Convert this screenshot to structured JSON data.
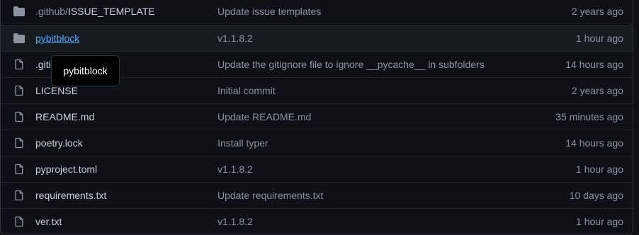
{
  "files": [
    {
      "icon": "folder-icon",
      "name_prefix": ".github/",
      "name": "ISSUE_TEMPLATE",
      "commit": "Update issue templates",
      "age": "2 years ago"
    },
    {
      "icon": "folder-icon",
      "name_prefix": "",
      "name": "pybitblock",
      "commit": "v1.1.8.2",
      "age": "1 hour ago"
    },
    {
      "icon": "file-icon",
      "name_prefix": "",
      "name": ".gitignore",
      "commit": "Update the gitignore file to ignore __pycache__ in subfolders",
      "age": "14 hours ago"
    },
    {
      "icon": "file-icon",
      "name_prefix": "",
      "name": "LICENSE",
      "commit": "Initial commit",
      "age": "2 years ago"
    },
    {
      "icon": "file-icon",
      "name_prefix": "",
      "name": "README.md",
      "commit": "Update README.md",
      "age": "35 minutes ago"
    },
    {
      "icon": "file-icon",
      "name_prefix": "",
      "name": "poetry.lock",
      "commit": "Install typer",
      "age": "14 hours ago"
    },
    {
      "icon": "file-icon",
      "name_prefix": "",
      "name": "pyproject.toml",
      "commit": "v1.1.8.2",
      "age": "1 hour ago"
    },
    {
      "icon": "file-icon",
      "name_prefix": "",
      "name": "requirements.txt",
      "commit": "Update requirements.txt",
      "age": "10 days ago"
    },
    {
      "icon": "file-icon",
      "name_prefix": "",
      "name": "ver.txt",
      "commit": "v1.1.8.2",
      "age": "1 hour ago"
    }
  ],
  "tooltip": {
    "text": "pybitblock"
  },
  "colors": {
    "background": "#0d1117",
    "text": "#c9d1d9",
    "muted": "#8b949e",
    "link": "#58a6ff",
    "folder": "#8b949e",
    "hover_row": "#161b22"
  }
}
